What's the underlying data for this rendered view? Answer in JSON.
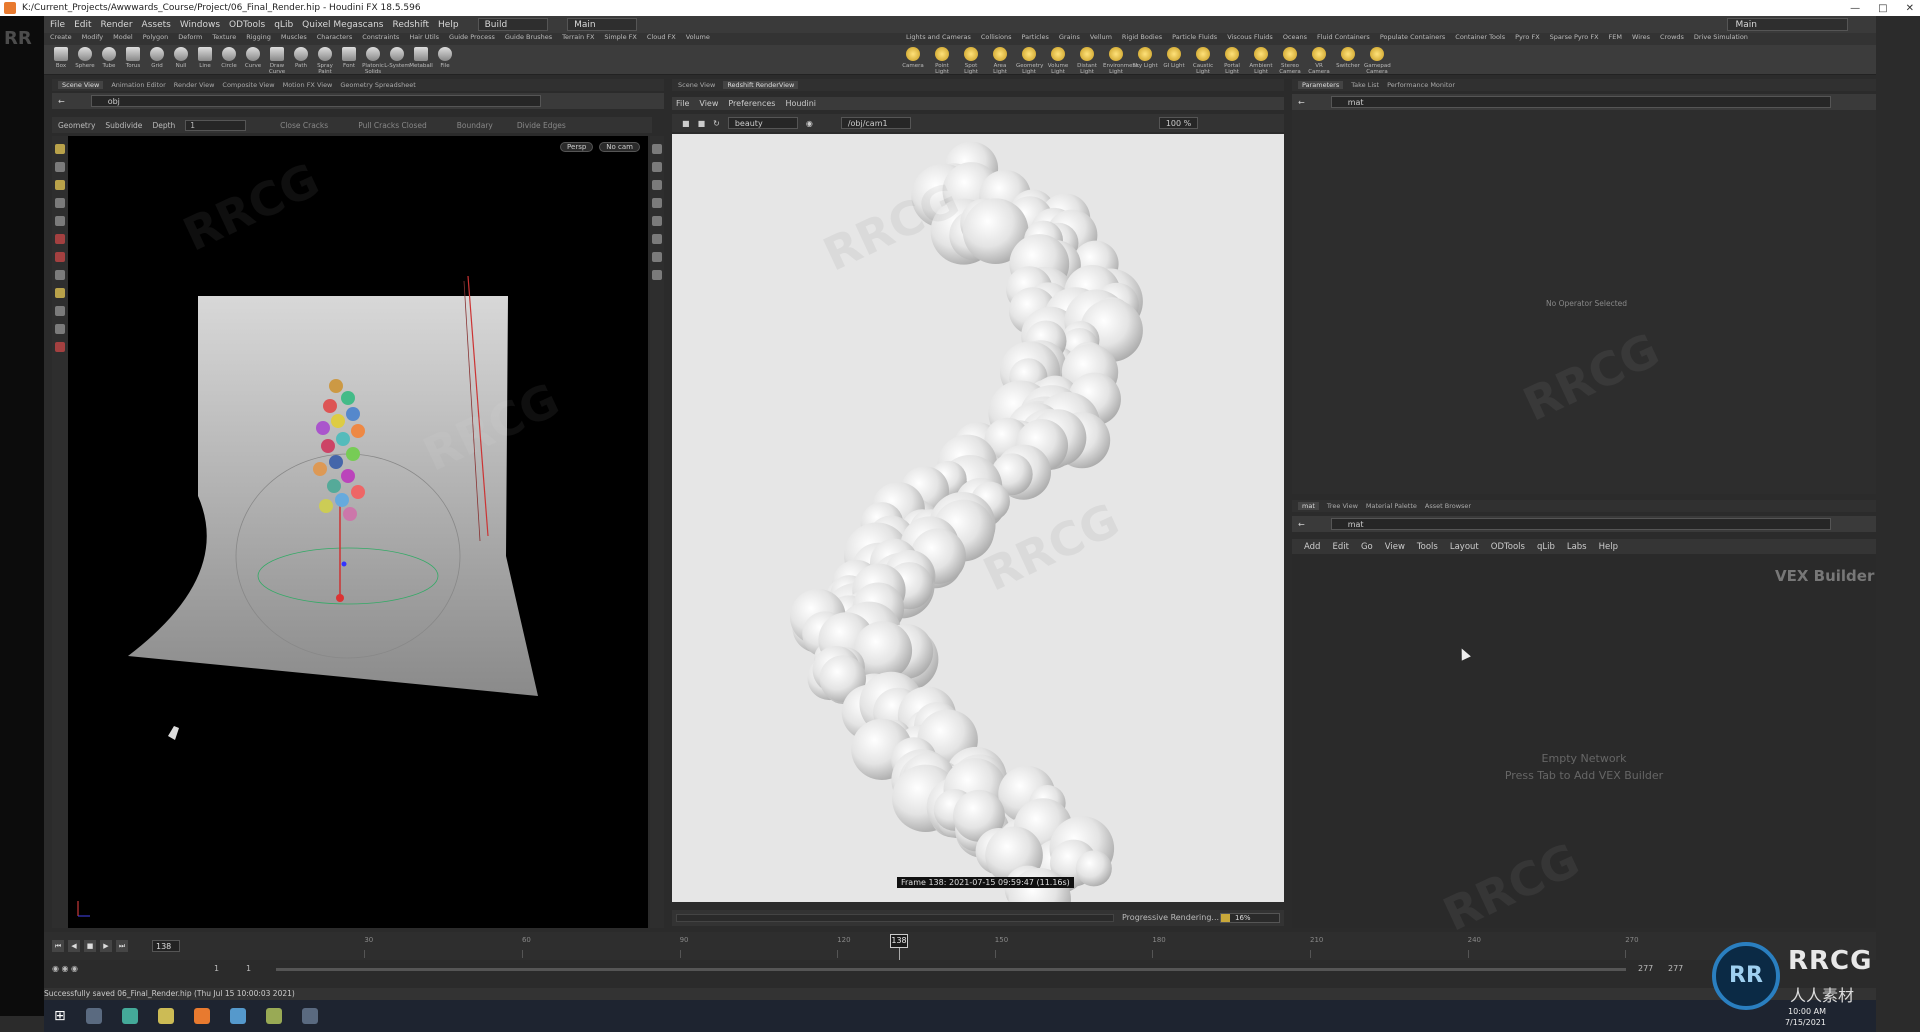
{
  "window": {
    "title": "K:/Current_Projects/Awwwards_Course/Project/06_Final_Render.hip - Houdini FX 18.5.596"
  },
  "menubar": {
    "items": [
      "File",
      "Edit",
      "Render",
      "Assets",
      "Windows",
      "ODTools",
      "qLib",
      "Quixel Megascans",
      "Redshift",
      "Help"
    ],
    "desktop": "Build",
    "main": "Main",
    "right_main": "Main"
  },
  "shelf": {
    "left_tabs": [
      "Create",
      "Modify",
      "Model",
      "Polygon",
      "Deform",
      "Texture",
      "Rigging",
      "Muscles",
      "Characters",
      "Constraints",
      "Hair Utils",
      "Guide Process",
      "Guide Brushes",
      "Terrain FX",
      "Simple FX",
      "Cloud FX",
      "Volume"
    ],
    "right_tabs": [
      "Lights and Cameras",
      "Collisions",
      "Particles",
      "Grains",
      "Vellum",
      "Rigid Bodies",
      "Particle Fluids",
      "Viscous Fluids",
      "Oceans",
      "Fluid Containers",
      "Populate Containers",
      "Container Tools",
      "Pyro FX",
      "Sparse Pyro FX",
      "FEM",
      "Wires",
      "Crowds",
      "Drive Simulation"
    ],
    "left_tools": [
      "Box",
      "Sphere",
      "Tube",
      "Torus",
      "Grid",
      "Null",
      "Line",
      "Circle",
      "Curve",
      "Draw Curve",
      "Path",
      "Spray Paint",
      "Font",
      "Platonic Solids",
      "L-System",
      "Metaball",
      "File"
    ],
    "right_tools": [
      "Camera",
      "Point Light",
      "Spot Light",
      "Area Light",
      "Geometry Light",
      "Volume Light",
      "Distant Light",
      "Environment Light",
      "Sky Light",
      "GI Light",
      "Caustic Light",
      "Portal Light",
      "Ambient Light",
      "Stereo Camera",
      "VR Camera",
      "Switcher",
      "Gamepad Camera"
    ]
  },
  "scene_pane": {
    "tabs": [
      "Scene View",
      "Animation Editor",
      "Render View",
      "Composite View",
      "Motion FX View",
      "Geometry Spreadsheet"
    ],
    "path": "obj",
    "toolbar": {
      "context": "Geometry",
      "subdivide": "Subdivide",
      "depth_label": "Depth",
      "depth_value": "1",
      "close_cracks": "Close Cracks",
      "pull_cracks": "Pull Cracks Closed",
      "boundary": "Boundary",
      "divide_edges": "Divide Edges"
    },
    "persp": "Persp",
    "cam": "No cam"
  },
  "render_pane": {
    "tabs": [
      "Scene View",
      "Redshift RenderView"
    ],
    "menu": [
      "File",
      "View",
      "Preferences",
      "Houdini"
    ],
    "aov": "beauty",
    "camera": "/obj/cam1",
    "zoom": "100 %",
    "frame_label": "Frame 138:  2021-07-15  09:59:47  (11.16s)",
    "progress_label": "Progressive Rendering...",
    "progress_value": "16%",
    "progress_fraction": 0.16
  },
  "params_pane": {
    "tabs": [
      "Parameters",
      "Take List",
      "Performance Monitor"
    ],
    "path": "mat",
    "empty": "No Operator Selected"
  },
  "network_pane": {
    "tabs": [
      "mat",
      "Tree View",
      "Material Palette",
      "Asset Browser"
    ],
    "path": "mat",
    "menu": [
      "Add",
      "Edit",
      "Go",
      "View",
      "Tools",
      "Layout",
      "ODTools",
      "qLib",
      "Labs",
      "Help"
    ],
    "title": "VEX Builder",
    "empty_line1": "Empty Network",
    "empty_line2": "Press Tab to Add VEX Builder"
  },
  "timeline": {
    "current_frame": "138",
    "playhead": "138",
    "ticks": [
      "30",
      "60",
      "90",
      "120",
      "150",
      "180",
      "210",
      "240",
      "270"
    ],
    "range_start": "1",
    "range_start2": "1",
    "range_end": "277",
    "range_end2": "277"
  },
  "status": {
    "message": "Successfully saved 06_Final_Render.hip (Thu Jul 15 10:00:03 2021)"
  },
  "taskbar": {
    "time": "10:00 AM",
    "date": "7/15/2021"
  },
  "watermark": {
    "logo": "RRCG",
    "sub": "人人素材"
  }
}
